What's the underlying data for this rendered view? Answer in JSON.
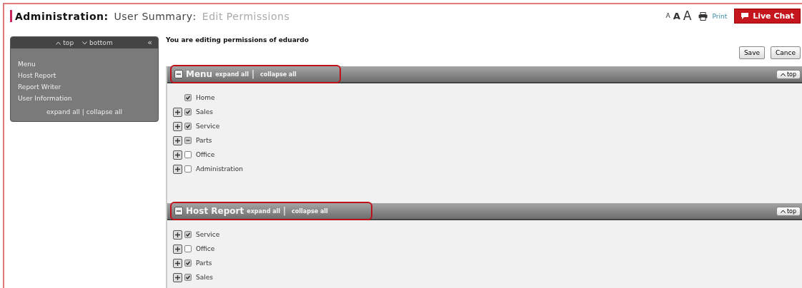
{
  "breadcrumb": [
    {
      "label": "Administration",
      "kind": "root",
      "separator": ":"
    },
    {
      "label": "User Summary",
      "kind": "parent",
      "separator": ":"
    },
    {
      "label": "Edit Permissions",
      "kind": "current"
    }
  ],
  "toolbar": {
    "font_sizes": [
      "A",
      "A",
      "A"
    ],
    "print": "Print",
    "live_chat": "Live Chat"
  },
  "sidebar": {
    "nav": [
      {
        "label": "top",
        "kind": "up"
      },
      {
        "label": "bottom",
        "kind": "down"
      }
    ],
    "collapse": "«",
    "items": [
      "Menu",
      "Host Report",
      "Report Writer",
      "User Information"
    ],
    "expand_all": "expand all",
    "separator": "|",
    "collapse_all": "collapse all"
  },
  "intro": "You are editing permissions of eduardo",
  "buttons": [
    "Save",
    "Cance"
  ],
  "sections": [
    {
      "title": "Menu",
      "highlighted": true,
      "expand_all": "expand all",
      "separator": "|",
      "collapse_all": "collapse all",
      "top": "top",
      "items": [
        {
          "label": "Home",
          "expandable": false,
          "checked": true,
          "mixed": false
        },
        {
          "label": "Sales",
          "expandable": true,
          "checked": true,
          "mixed": false
        },
        {
          "label": "Service",
          "expandable": true,
          "checked": true,
          "mixed": false
        },
        {
          "label": "Parts",
          "expandable": true,
          "checked": false,
          "mixed": true
        },
        {
          "label": "Office",
          "expandable": true,
          "checked": false,
          "mixed": false
        },
        {
          "label": "Administration",
          "expandable": true,
          "checked": false,
          "mixed": false
        }
      ]
    },
    {
      "title": "Host Report",
      "highlighted": true,
      "expand_all": "expand all",
      "separator": "|",
      "collapse_all": "collapse all",
      "top": "top",
      "items": [
        {
          "label": "Service",
          "expandable": true,
          "checked": true,
          "mixed": false
        },
        {
          "label": "Office",
          "expandable": true,
          "checked": false,
          "mixed": false
        },
        {
          "label": "Parts",
          "expandable": true,
          "checked": true,
          "mixed": false
        },
        {
          "label": "Sales",
          "expandable": true,
          "checked": true,
          "mixed": false
        }
      ]
    }
  ]
}
